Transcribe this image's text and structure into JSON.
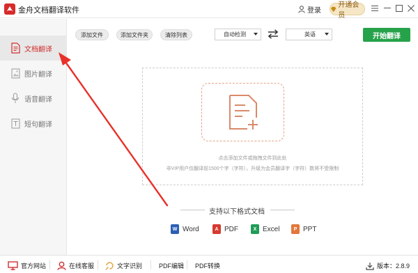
{
  "titlebar": {
    "app_title": "金舟文档翻译软件",
    "login_label": "登录",
    "vip_label": "开通会员",
    "icons": [
      "user-icon",
      "diamond-icon",
      "menu-icon",
      "minimize-icon",
      "maximize-icon",
      "close-icon"
    ]
  },
  "sidebar": {
    "items": [
      {
        "label": "文档翻译",
        "icon": "document-icon",
        "active": true
      },
      {
        "label": "图片翻译",
        "icon": "image-icon",
        "active": false
      },
      {
        "label": "语音翻译",
        "icon": "microphone-icon",
        "active": false
      },
      {
        "label": "短句翻译",
        "icon": "text-icon",
        "active": false
      }
    ]
  },
  "toolbar": {
    "add_file": "添加文件",
    "add_folder": "添加文件夹",
    "clear_list": "清除列表",
    "source_lang": "自动检测",
    "target_lang": "英语",
    "start_label": "开始翻译"
  },
  "drop_area": {
    "hint": "点击添加文件或拖拽文件到此处",
    "limit_note": "非VIP用户仅翻译前1500个字（字符），升级为会员翻译字（字符）数将不受限制"
  },
  "formats": {
    "title": "支持以下格式文档",
    "items": [
      {
        "label": "Word",
        "color": "#2b5fb5",
        "glyph": "W"
      },
      {
        "label": "PDF",
        "color": "#d63a2f",
        "glyph": "A"
      },
      {
        "label": "Excel",
        "color": "#1f9d57",
        "glyph": "X"
      },
      {
        "label": "PPT",
        "color": "#e2773b",
        "glyph": "P"
      }
    ]
  },
  "bottombar": {
    "official_site": "官方网站",
    "online_service": "在线客服",
    "ocr": "文字识别",
    "pdf_edit": "PDF编辑",
    "pdf_convert": "PDF转换",
    "version": "版本：2.8.9"
  },
  "colors": {
    "accent_red": "#d03030",
    "start_green": "#26a24a",
    "vip_gold": "#f5e7c6",
    "annotation_arrow": "#e8312a"
  }
}
